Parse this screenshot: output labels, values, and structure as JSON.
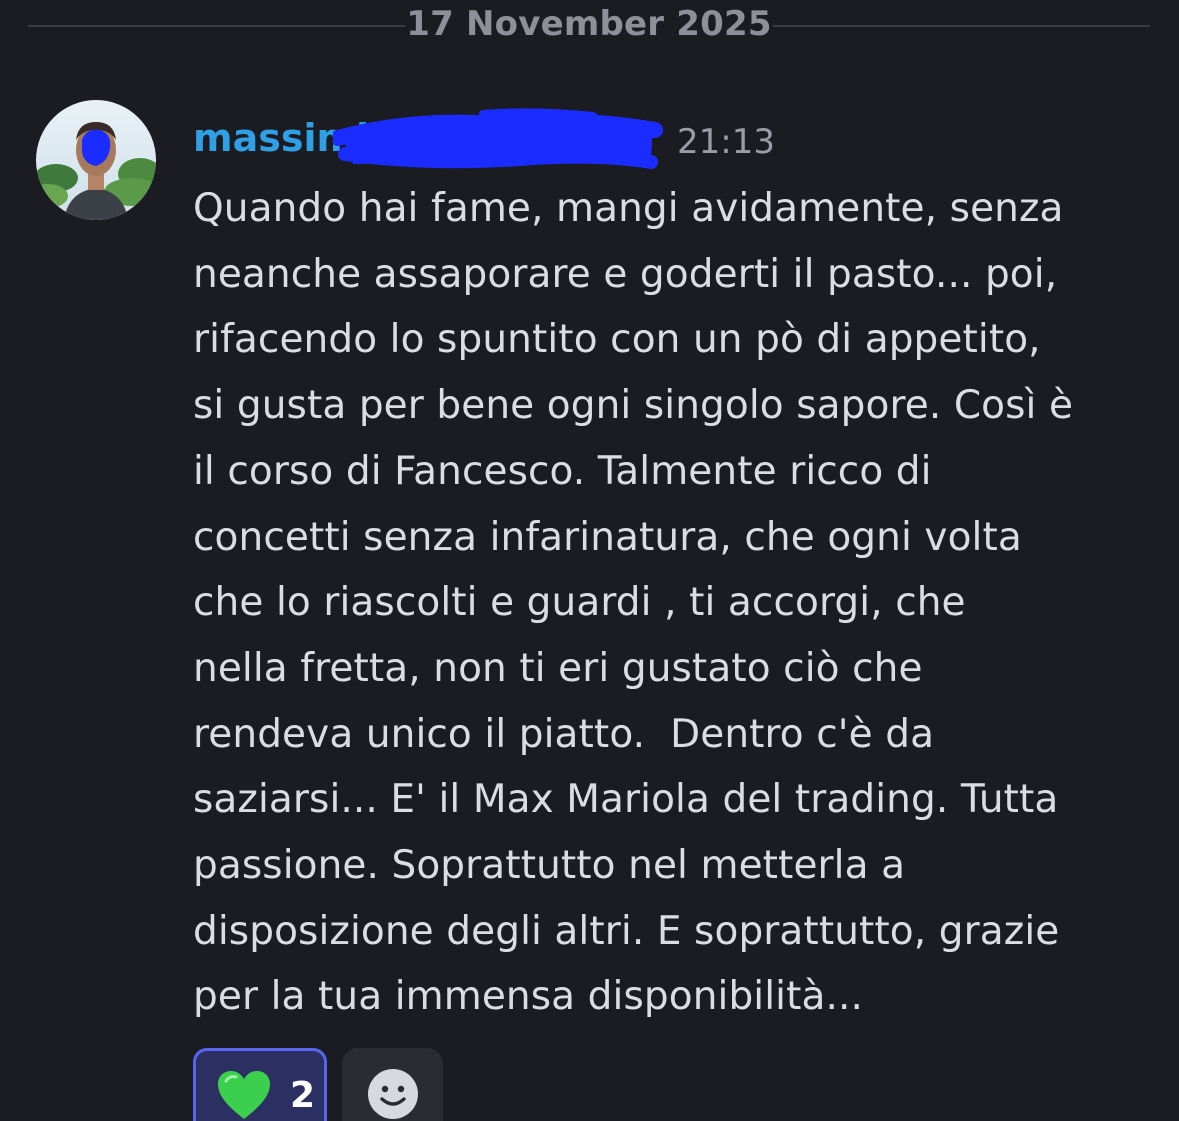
{
  "date_divider": "17 November 2025",
  "message": {
    "username": "massimili",
    "timestamp": "21:13",
    "lines": [
      "Quando hai fame, mangi avidamente, senza",
      "neanche assaporare e goderti il pasto... poi,",
      "rifacendo lo spuntito con un pò di appetito,",
      "si gusta per bene ogni singolo sapore. Così è",
      "il corso di Fancesco. Talmente ricco di",
      "concetti senza infarinatura, che ogni volta",
      "che lo riascolti e guardi , ti accorgi, che",
      "nella fretta, non ti eri gustato ciò che",
      "rendeva unico il piatto.  Dentro c'è da",
      "saziarsi... E' il Max Mariola del trading. Tutta",
      "passione. Soprattutto nel metterla a",
      "disposizione degli altri. E soprattutto, grazie",
      "per la tua immensa disponibilità..."
    ]
  },
  "reactions": [
    {
      "emoji": "green-heart-icon",
      "count": "2",
      "selected": true,
      "color": "#3ccf4e"
    }
  ],
  "add_reaction_icon": "smiley-icon",
  "colors": {
    "background": "#1b1c21",
    "username": "#2f9fe6",
    "redaction": "#1a2cff",
    "reaction_border": "#5865f2",
    "reaction_bg": "#2b2f61"
  }
}
